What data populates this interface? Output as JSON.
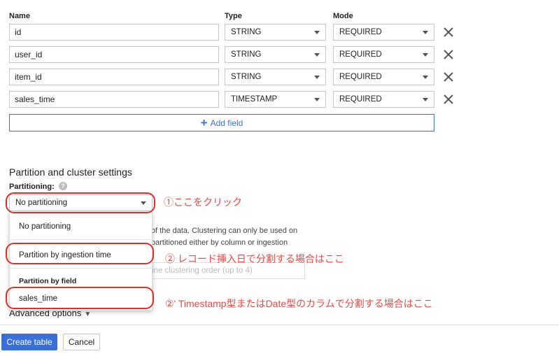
{
  "headers": {
    "name": "Name",
    "type": "Type",
    "mode": "Mode"
  },
  "fields": [
    {
      "name": "id",
      "type": "STRING",
      "mode": "REQUIRED"
    },
    {
      "name": "user_id",
      "type": "STRING",
      "mode": "REQUIRED"
    },
    {
      "name": "item_id",
      "type": "STRING",
      "mode": "REQUIRED"
    },
    {
      "name": "sales_time",
      "type": "TIMESTAMP",
      "mode": "REQUIRED"
    }
  ],
  "add_field_label": "Add field",
  "partition": {
    "section_title": "Partition and cluster settings",
    "label": "Partitioning:",
    "help_icon": "?",
    "selected": "No partitioning",
    "options": {
      "no_partitioning": "No partitioning",
      "ingestion": "Partition by ingestion time",
      "group_label": "Partition by field",
      "field": "sales_time"
    }
  },
  "clustering": {
    "line1": "of the data. Clustering can only be used on",
    "line2": "partitioned either by column or ingestion",
    "placeholder": "ine clustering order (up to 4)"
  },
  "advanced_options": "Advanced options",
  "buttons": {
    "create": "Create table",
    "cancel": "Cancel"
  },
  "annotations": {
    "click_here": "①ここをクリック",
    "ingestion_note": "② レコード挿入日で分割する場合はここ",
    "field_note": "②' Timestamp型またはDate型のカラムで分割する場合はここ"
  },
  "colors": {
    "accent": "#3b6fd8",
    "annotation": "#e02e2e",
    "annotation_text": "#e84a4a"
  }
}
